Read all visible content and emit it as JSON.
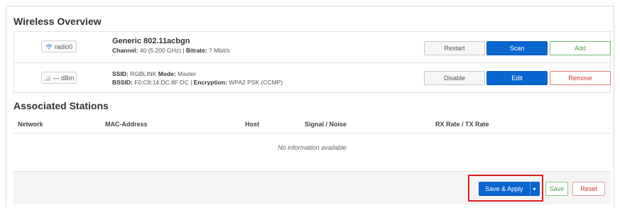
{
  "wireless": {
    "title": "Wireless Overview",
    "device": {
      "badge": "radio0",
      "name": "Generic 802.11acbgn",
      "channel_label": "Channel:",
      "channel_value": "40 (5.200 GHz)",
      "bitrate_label": "Bitrate:",
      "bitrate_value": "? Mbit/s",
      "buttons": {
        "restart": "Restart",
        "scan": "Scan",
        "add": "Add"
      }
    },
    "network": {
      "badge": "— dBm",
      "ssid_label": "SSID:",
      "ssid_value": "RGBLINK",
      "mode_label": "Mode:",
      "mode_value": "Master",
      "bssid_label": "BSSID:",
      "bssid_value": "F0:C8:14:DC:8F:DC",
      "encryption_label": "Encryption:",
      "encryption_value": "WPA2 PSK (CCMP)",
      "buttons": {
        "disable": "Disable",
        "edit": "Edit",
        "remove": "Remove"
      }
    }
  },
  "stations": {
    "title": "Associated Stations",
    "columns": [
      "Network",
      "MAC-Address",
      "Host",
      "Signal / Noise",
      "RX Rate / TX Rate"
    ],
    "empty_message": "No information available"
  },
  "footer": {
    "save_apply": "Save & Apply",
    "dropdown_glyph": "▾",
    "save": "Save",
    "reset": "Reset"
  },
  "colors": {
    "primary": "#0a66cf",
    "highlight": "#d9201e",
    "add_green": "#4a9e4a",
    "remove_red": "#c9302c"
  },
  "icons": {
    "device": "wifi-icon",
    "network": "signal-icon"
  }
}
